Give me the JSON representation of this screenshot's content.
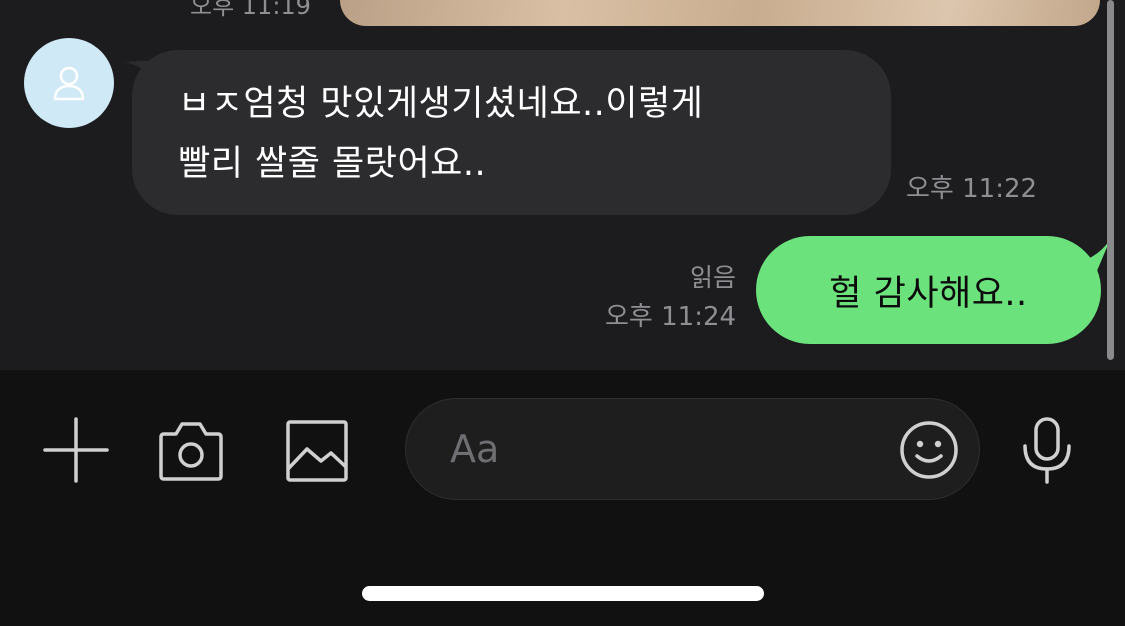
{
  "chat": {
    "previous_message": {
      "time": "오후 11:19",
      "type": "image"
    },
    "incoming": {
      "avatar_icon": "person-icon",
      "lines": [
        "ㅂㅈ엄청 맛있게생기셨네요..이렇게",
        "빨리 쌀줄 몰랏어요.."
      ],
      "time": "오후 11:22"
    },
    "outgoing": {
      "text": "헐 감사해요..",
      "read_label": "읽음",
      "time": "오후 11:24"
    }
  },
  "input_bar": {
    "placeholder": "Aa",
    "icons": [
      "plus-icon",
      "camera-icon",
      "image-icon",
      "emoji-icon",
      "microphone-icon"
    ]
  },
  "colors": {
    "background": "#1c1c1e",
    "incoming_bubble": "#2c2c2e",
    "outgoing_bubble": "#6ce27c",
    "input_bar": "#111111",
    "meta_text": "#8e8e93",
    "avatar_bg": "#cfe9f7"
  }
}
